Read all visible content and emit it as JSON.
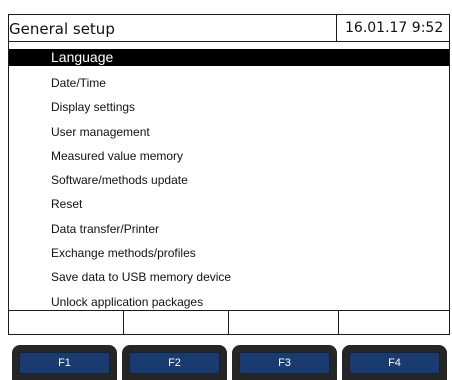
{
  "header": {
    "title": "General setup",
    "datetime": "16.01.17  9:52"
  },
  "menu": {
    "items": [
      {
        "label": "Language",
        "selected": true
      },
      {
        "label": "Date/Time"
      },
      {
        "label": "Display settings"
      },
      {
        "label": "User management"
      },
      {
        "label": "Measured value memory"
      },
      {
        "label": "Software/methods update"
      },
      {
        "label": "Reset"
      },
      {
        "label": "Data transfer/Printer"
      },
      {
        "label": "Exchange methods/profiles"
      },
      {
        "label": "Save data to USB memory device"
      },
      {
        "label": "Unlock application packages"
      }
    ]
  },
  "softkeys": {
    "labels": [
      "",
      "",
      "",
      ""
    ]
  },
  "function_keys": {
    "labels": [
      "F1",
      "F2",
      "F3",
      "F4"
    ]
  },
  "colors": {
    "selection": "#000000",
    "fkey_body": "#262626",
    "fkey_face": "#1a3b70"
  }
}
